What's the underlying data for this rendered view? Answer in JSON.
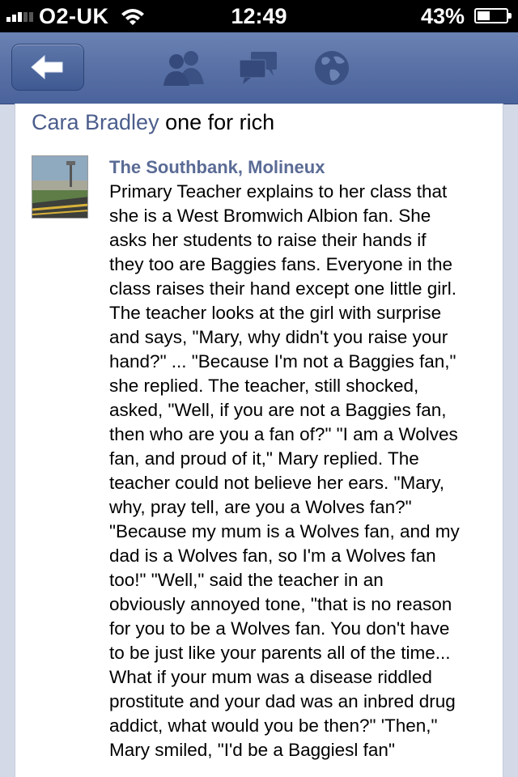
{
  "status_bar": {
    "carrier": "O2-UK",
    "time": "12:49",
    "battery_percent": "43%",
    "battery_level": 0.43,
    "signal_bars": 3
  },
  "nav": {
    "back_icon": "back-arrow-icon",
    "icons": [
      "friends-icon",
      "messages-icon",
      "globe-icon"
    ]
  },
  "post": {
    "author": "Cara Bradley",
    "message": "one for rich",
    "link_title": "The Southbank, Molineux",
    "link_lines": [
      "Primary Teacher explains to her class that",
      "she is a West Bromwich Albion fan. She",
      "asks her students to raise their hands if",
      "they too are Baggies fans. Everyone in the",
      "class raises their hand except one little girl.",
      "The teacher looks at the girl with surprise",
      "and says, \"Mary, why didn't you raise your",
      "hand?\" ... \"Because I'm not a Baggies fan,\"",
      "she replied. The teacher, still shocked,",
      "asked, \"Well, if you are not a Baggies fan,",
      "then who are you a fan of?\" \"I am a Wolves",
      "fan, and proud of it,\" Mary replied. The",
      "teacher could not believe her ears. \"Mary,",
      "why, pray tell, are you a Wolves fan?\"",
      "\"Because my mum is a Wolves fan, and my",
      "dad is a Wolves fan, so I'm a Wolves fan",
      "too!\" \"Well,\" said the teacher in an",
      "obviously annoyed tone, \"that is no reason",
      "for you to be a Wolves fan. You don't have",
      "to be just like your parents all of the time...",
      "What if your mum was a disease riddled",
      "prostitute and your dad was an inbred drug",
      "addict, what would you be then?\" 'Then,\"",
      "Mary smiled, \"I'd be a Baggiesl fan\""
    ]
  },
  "colors": {
    "nav_bar": "#5a72a6",
    "author_link": "#4b5d8c",
    "link_title": "#5a6b95"
  }
}
